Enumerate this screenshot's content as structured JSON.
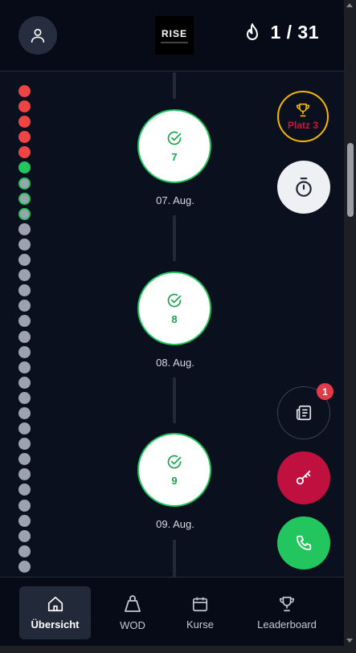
{
  "header": {
    "logo_text": "RISE",
    "streak": "1 / 31"
  },
  "calendar_dots": [
    "red",
    "red",
    "red",
    "red",
    "red",
    "green",
    "ring",
    "ring",
    "ring",
    "gray",
    "gray",
    "gray",
    "gray",
    "gray",
    "gray",
    "gray",
    "gray",
    "gray",
    "gray",
    "gray",
    "gray",
    "gray",
    "gray",
    "gray",
    "gray",
    "gray",
    "gray",
    "gray",
    "gray",
    "gray",
    "gray",
    "gray"
  ],
  "timeline": [
    {
      "day": "7",
      "date": "07. Aug.",
      "status": "done"
    },
    {
      "day": "8",
      "date": "08. Aug.",
      "status": "done"
    },
    {
      "day": "9",
      "date": "09. Aug.",
      "status": "done"
    }
  ],
  "rank": {
    "label": "Platz 3"
  },
  "news": {
    "count": "1"
  },
  "nav": [
    {
      "label": "Übersicht",
      "icon": "home-icon",
      "active": true
    },
    {
      "label": "WOD",
      "icon": "kettlebell-icon",
      "active": false
    },
    {
      "label": "Kurse",
      "icon": "calendar-icon",
      "active": false
    },
    {
      "label": "Leaderboard",
      "icon": "trophy-icon",
      "active": false
    }
  ],
  "colors": {
    "background": "#0b101e",
    "accent_red": "#c0103f",
    "success_green": "#22c55e",
    "gold": "#f5b700"
  }
}
